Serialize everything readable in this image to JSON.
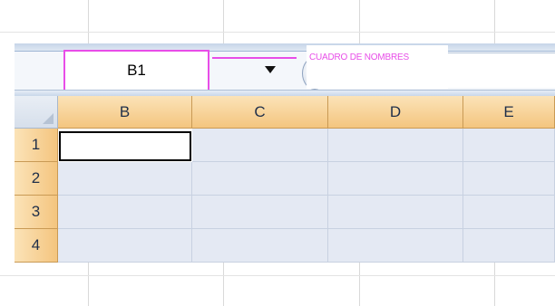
{
  "name_box": {
    "value": "B1"
  },
  "annotation": {
    "label": "CUADRO DE NOMBRES",
    "color": "#e84de8"
  },
  "columns": [
    "B",
    "C",
    "D",
    "E"
  ],
  "rows": [
    "1",
    "2",
    "3",
    "4"
  ],
  "selected_cell": "B1",
  "colors": {
    "header_fill": "#f4c57f",
    "cell_fill": "#e4e9f3",
    "annotation": "#e84de8"
  },
  "icons": {
    "dropdown": "dropdown-arrow-icon",
    "function": "insert-function-icon",
    "select_all": "select-all-icon"
  }
}
